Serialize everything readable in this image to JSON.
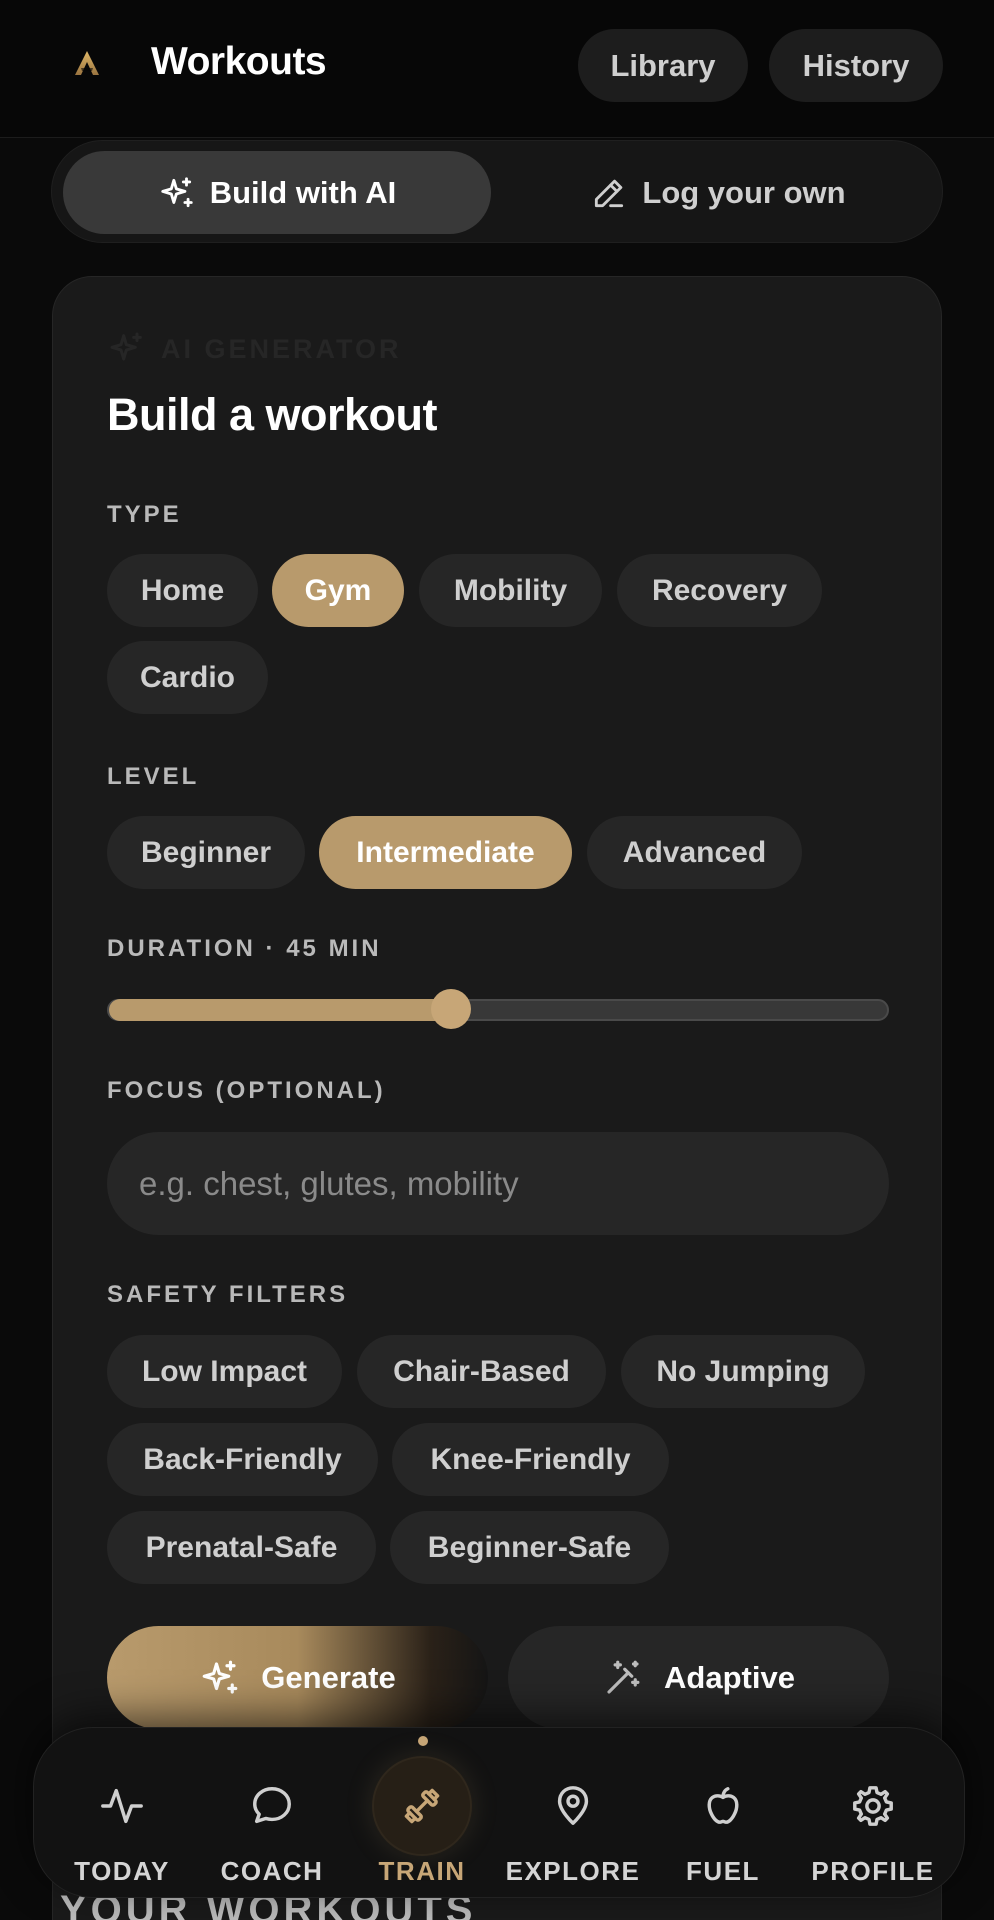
{
  "header": {
    "title": "Workouts",
    "library_label": "Library",
    "history_label": "History"
  },
  "mode": {
    "build_ai_label": "Build with AI",
    "log_own_label": "Log your own",
    "active": "build_ai"
  },
  "card": {
    "eyebrow": "AI GENERATOR",
    "title": "Build a workout",
    "type_label": "TYPE",
    "type_options": [
      "Home",
      "Gym",
      "Mobility",
      "Recovery",
      "Cardio"
    ],
    "type_selected": "Gym",
    "level_label": "LEVEL",
    "level_options": [
      "Beginner",
      "Intermediate",
      "Advanced"
    ],
    "level_selected": "Intermediate",
    "duration_label": "DURATION · 45 MIN",
    "duration_fraction": 0.44,
    "focus_label": "FOCUS (OPTIONAL)",
    "focus_placeholder": "e.g. chest, glutes, mobility",
    "focus_value": "",
    "safety_label": "SAFETY FILTERS",
    "safety_options": [
      "Low Impact",
      "Chair-Based",
      "No Jumping",
      "Back-Friendly",
      "Knee-Friendly",
      "Prenatal-Safe",
      "Beginner-Safe"
    ],
    "generate_label": "Generate",
    "adaptive_label": "Adaptive"
  },
  "section_peek": "YOUR WORKOUTS",
  "nav": {
    "items": [
      {
        "label": "TODAY",
        "icon": "activity-icon"
      },
      {
        "label": "COACH",
        "icon": "chat-bubble-icon"
      },
      {
        "label": "TRAIN",
        "icon": "dumbbell-icon"
      },
      {
        "label": "EXPLORE",
        "icon": "map-pin-icon"
      },
      {
        "label": "FUEL",
        "icon": "apple-icon"
      },
      {
        "label": "PROFILE",
        "icon": "gear-icon"
      }
    ],
    "active": "TRAIN"
  },
  "colors": {
    "accent": "#b89a6c",
    "background": "#0a0a0a",
    "card": "#1a1a1a",
    "chip": "#262626"
  }
}
